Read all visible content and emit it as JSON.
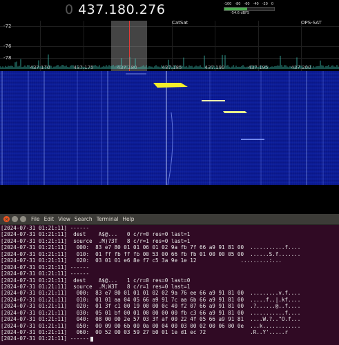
{
  "sdr": {
    "frequency_lead": "0",
    "frequency": "437.180.276",
    "level_meter": {
      "ticks": [
        "-100",
        "-80",
        "-60",
        "-40",
        "-20",
        "0"
      ],
      "readout": "-54.6 dBFS",
      "fraction": 0.46,
      "color": "#4caf50"
    },
    "db_labels": [
      "-72",
      "-76",
      "-78"
    ],
    "markers": [
      {
        "label": "CatSat"
      },
      {
        "label": "OPS-SAT"
      }
    ],
    "freq_ticks": [
      "437.170",
      "437.175",
      "437.180",
      "437.185",
      "437.190",
      "437.195",
      "437.200"
    ],
    "colors": {
      "waterfall_base": "#0d1f9c",
      "signal_hot": "#f4ef2a",
      "selection_center": "#e53935",
      "spectrum_trace": "#3fd0c0"
    }
  },
  "terminal": {
    "menu": [
      "File",
      "Edit",
      "View",
      "Search",
      "Terminal",
      "Help"
    ],
    "lines": [
      "[2024-07-31 01:21:11] ------",
      "[2024-07-31 01:21:11]  dest    A$@...   0 c/r=0 res=0 last=1",
      "[2024-07-31 01:21:11]  source  .M)?3T   8 c/r=1 res=0 last=1",
      "[2024-07-31 01:21:11]   000:  83 e7 80 01 01 06 01 02 9a fb 7f 66 a9 91 81 00  ...........f....",
      "[2024-07-31 01:21:11]   010:  01 ff fb ff fb 00 53 00 66 fb fb 01 00 00 05 00  ......S.f.......",
      "[2024-07-31 01:21:11]   020:  03 01 01 e6 8e f7 c5 3a 9e 1e 12              .........:...",
      "[2024-07-31 01:21:11] ------",
      "[2024-07-31 01:21:11] ------",
      "[2024-07-31 01:21:11]  dest    A$@...   1 c/r=0 res=0 last=0",
      "[2024-07-31 01:21:11]  source  .M;W3T   8 c/r=1 res=0 last=1",
      "[2024-07-31 01:21:11]   000:  83 e7 80 01 01 01 02 02 9a 76 ee 66 a9 91 81 00  .........v.f....",
      "[2024-07-31 01:21:11]   010:  01 01 aa 04 05 66 a9 91 7c aa 6b 66 a9 91 81 00  .....f..|.kf....",
      "[2024-07-31 01:21:11]   020:  01 3f c1 00 19 00 00 0c 40 f2 07 66 a9 91 81 00  .?......@..f....",
      "[2024-07-31 01:21:11]   030:  05 01 bf 00 01 00 00 00 00 fb c3 66 a9 91 81 00  ...........f....",
      "[2024-07-31 01:21:11]   040:  08 00 00 2e 57 03 3f af 00 22 4f 05 66 a9 91 81  ....W.?..\"O.f...",
      "[2024-07-31 01:21:11]   050:  00 09 00 6b 00 0a 00 04 00 03 00 02 00 06 00 0e  ...k............",
      "[2024-07-31 01:21:11]   060:  00 52 00 03 59 27 b0 01 1e d1 ec 72              .R..Y'.....r",
      "[2024-07-31 01:21:11] ------"
    ]
  }
}
